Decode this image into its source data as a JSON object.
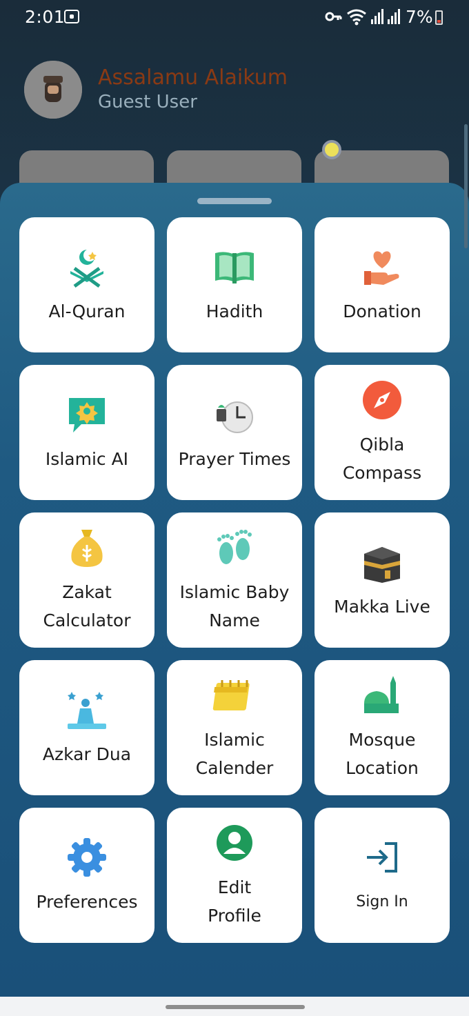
{
  "status_bar": {
    "time": "2:01",
    "battery": "7%",
    "icons": [
      "screen-record-icon",
      "key-icon",
      "wifi-icon",
      "signal-icon",
      "signal-icon",
      "battery-icon"
    ]
  },
  "header": {
    "greeting": "Assalamu Alaikum",
    "user": "Guest User",
    "greeting_color": "#8a3a14"
  },
  "menu": [
    {
      "label": "Al-Quran",
      "icon": "quran-icon"
    },
    {
      "label": "Hadith",
      "icon": "book-icon"
    },
    {
      "label": "Donation",
      "icon": "donation-icon"
    },
    {
      "label": "Islamic AI",
      "icon": "chat-ai-icon"
    },
    {
      "label": "Prayer Times",
      "icon": "clock-icon"
    },
    {
      "label": "Qibla Compass",
      "icon": "compass-icon"
    },
    {
      "label": "Zakat Calculator",
      "icon": "money-bag-icon"
    },
    {
      "label": "Islamic Baby Name",
      "icon": "baby-feet-icon"
    },
    {
      "label": "Makka Live",
      "icon": "kaaba-icon"
    },
    {
      "label": "Azkar Dua",
      "icon": "praying-icon"
    },
    {
      "label": "Islamic Calender",
      "icon": "calendar-icon"
    },
    {
      "label": "Mosque Location",
      "icon": "mosque-icon"
    },
    {
      "label": "Preferences",
      "icon": "gear-icon"
    },
    {
      "label": "Edit Profile",
      "icon": "profile-icon"
    },
    {
      "label": "Sign In",
      "icon": "sign-in-icon"
    }
  ]
}
